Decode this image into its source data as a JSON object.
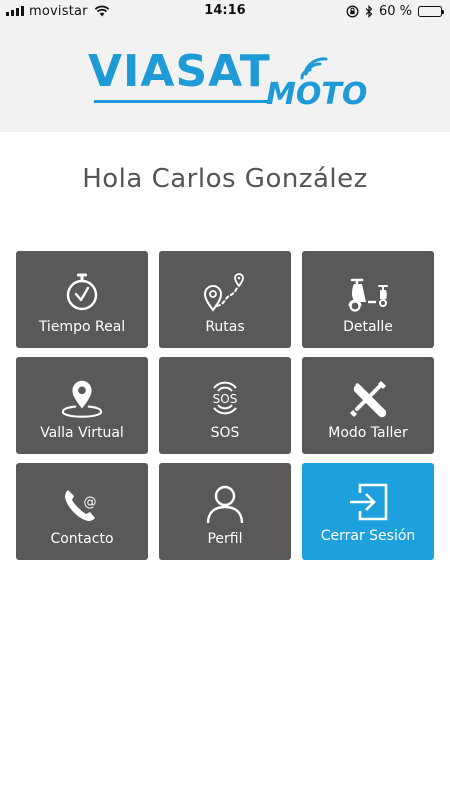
{
  "status_bar": {
    "carrier": "movistar",
    "time": "14:16",
    "battery_percent_text": "60 %",
    "battery_level": 0.6
  },
  "header": {
    "logo_main": "VIASAT",
    "logo_sub": "MOTO",
    "brand_color": "#1e9ad6"
  },
  "greeting": "Hola Carlos González",
  "menu": [
    {
      "label": "Tiempo Real",
      "icon": "stopwatch-icon"
    },
    {
      "label": "Rutas",
      "icon": "route-icon"
    },
    {
      "label": "Detalle",
      "icon": "scooter-icon"
    },
    {
      "label": "Valla Virtual",
      "icon": "geofence-pin-icon"
    },
    {
      "label": "SOS",
      "icon": "sos-icon"
    },
    {
      "label": "Modo Taller",
      "icon": "tools-icon"
    },
    {
      "label": "Contacto",
      "icon": "phone-email-icon"
    },
    {
      "label": "Perfil",
      "icon": "user-icon"
    },
    {
      "label": "Cerrar Sesión",
      "icon": "logout-icon"
    }
  ],
  "colors": {
    "tile": "#5a5957",
    "logout_tile": "#1ea0dc"
  }
}
